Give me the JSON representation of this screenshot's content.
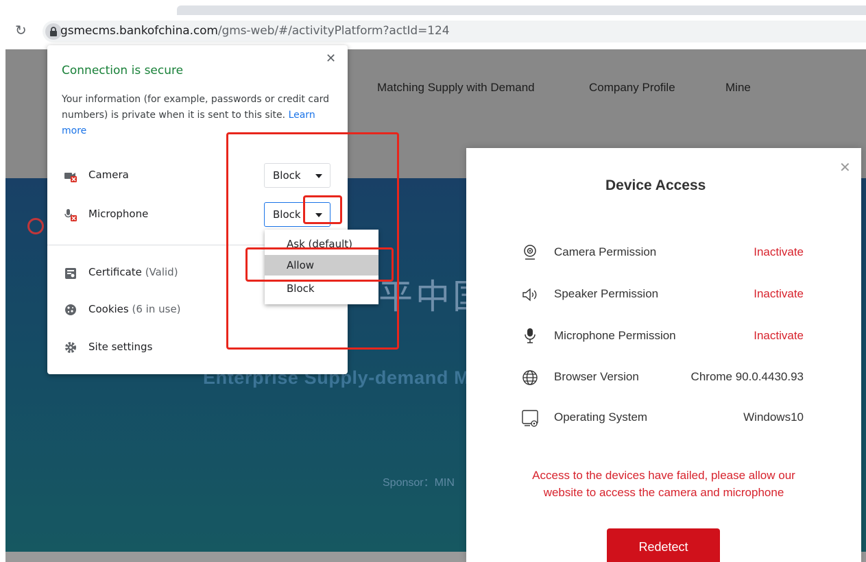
{
  "browser": {
    "url_host": "gsmecms.bankofchina.com",
    "url_path": "/gms-web/#/activityPlatform?actId=124"
  },
  "page": {
    "nav": [
      "Matching Supply with Demand",
      "Company Profile",
      "Mine"
    ],
    "hero_title_cn": "平中国",
    "hero_subtitle": "Enterprise Supply-demand M",
    "sponsor": "Sponsor：MIN"
  },
  "site_info": {
    "title": "Connection is secure",
    "description": "Your information (for example, passwords or credit card numbers) is private when it is sent to this site.",
    "learn_more": "Learn more",
    "camera_label": "Camera",
    "camera_value": "Block",
    "microphone_label": "Microphone",
    "microphone_value": "Block",
    "certificate_label": "Certificate",
    "certificate_status": "(Valid)",
    "cookies_label": "Cookies",
    "cookies_status": "(6 in use)",
    "site_settings_label": "Site settings",
    "dropdown_options": [
      "Ask (default)",
      "Allow",
      "Block"
    ],
    "highlighted_option": "Allow"
  },
  "device_access": {
    "title": "Device Access",
    "rows": [
      {
        "label": "Camera Permission",
        "value": "Inactivate",
        "icon": "camera-icon"
      },
      {
        "label": "Speaker Permission",
        "value": "Inactivate",
        "icon": "speaker-icon"
      },
      {
        "label": "Microphone Permission",
        "value": "Inactivate",
        "icon": "microphone-icon"
      },
      {
        "label": "Browser Version",
        "value": "Chrome 90.0.4430.93",
        "icon": "globe-icon"
      },
      {
        "label": "Operating System",
        "value": "Windows10",
        "icon": "computer-icon"
      }
    ],
    "failure_message_line1": "Access to the devices have failed, please allow our",
    "failure_message_line2": "website to access the camera and microphone",
    "redetect_label": "Redetect"
  },
  "colors": {
    "secure_green": "#188038",
    "link_blue": "#1a73e8",
    "error_red": "#d7222c",
    "button_red": "#d0111b",
    "annotation_red": "#e8261c"
  }
}
